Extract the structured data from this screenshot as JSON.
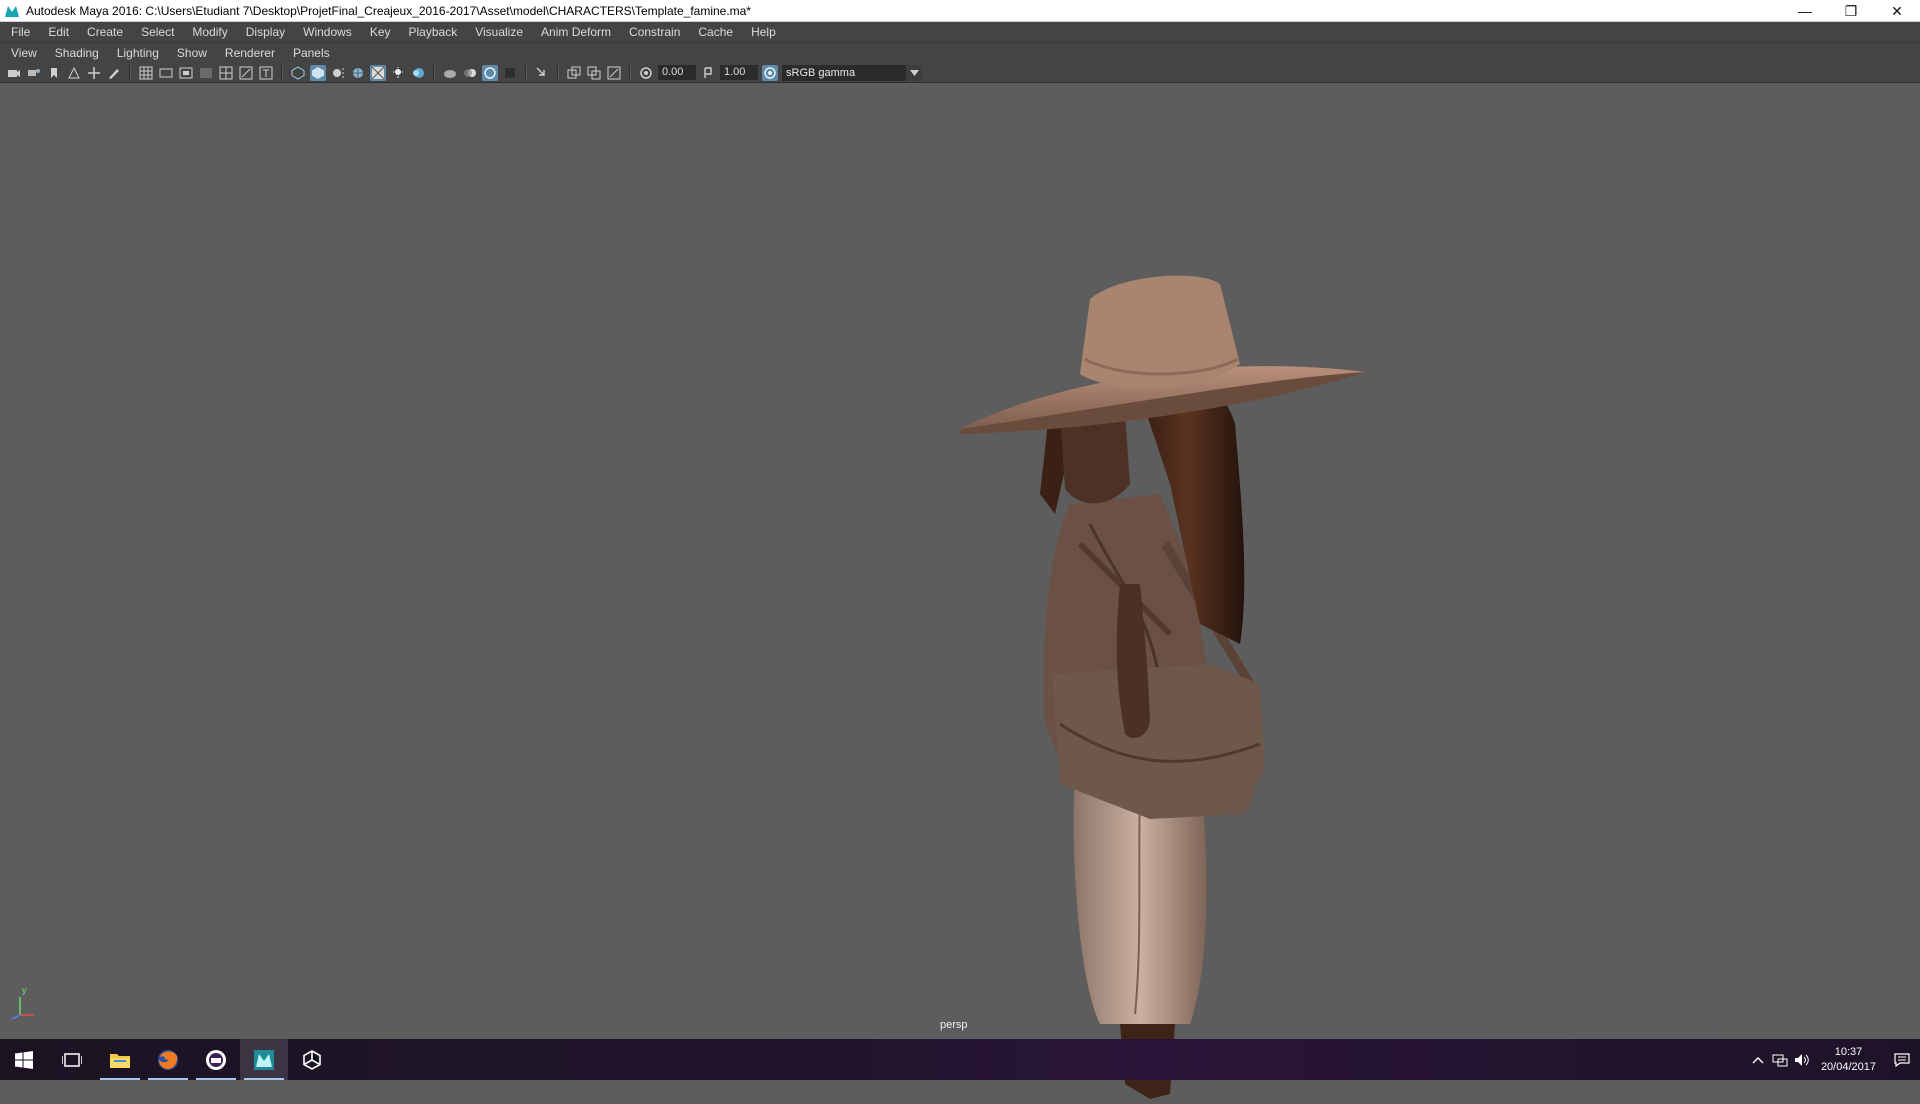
{
  "window": {
    "title": "Autodesk Maya 2016: C:\\Users\\Etudiant 7\\Desktop\\ProjetFinal_Creajeux_2016-2017\\Asset\\model\\CHARACTERS\\Template_famine.ma*",
    "controls": [
      "minimize",
      "restore",
      "close"
    ]
  },
  "main_menu": [
    "File",
    "Edit",
    "Create",
    "Select",
    "Modify",
    "Display",
    "Windows",
    "Key",
    "Playback",
    "Visualize",
    "Anim Deform",
    "Constrain",
    "Cache",
    "Help"
  ],
  "panel_menu": [
    "View",
    "Shading",
    "Lighting",
    "Show",
    "Renderer",
    "Panels"
  ],
  "toolbar": {
    "exposure_value": "0.00",
    "gamma_value": "1.00",
    "color_space": "sRGB gamma"
  },
  "viewport": {
    "camera_label": "persp",
    "axis_label": "y"
  },
  "taskbar": {
    "apps": [
      "start-icon",
      "task-view-icon",
      "file-explorer-icon",
      "firefox-icon",
      "app-icon",
      "maya-icon",
      "unity-icon"
    ],
    "clock_time": "10:37",
    "clock_date": "20/04/2017"
  },
  "colors": {
    "viewport_bg": "#5d5d5d",
    "menu_bg": "#444444",
    "accent": "#5e8aa8"
  }
}
